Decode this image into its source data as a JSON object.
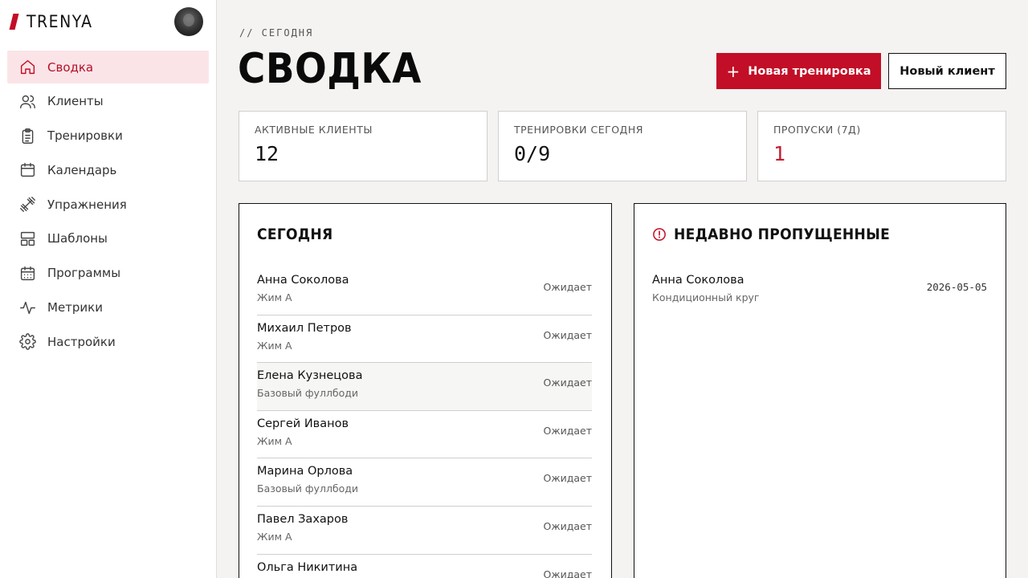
{
  "brand": {
    "name": "TRENYA"
  },
  "nav": [
    {
      "label": "Сводка",
      "icon": "home-icon",
      "active": true
    },
    {
      "label": "Клиенты",
      "icon": "users-icon"
    },
    {
      "label": "Тренировки",
      "icon": "clipboard-icon"
    },
    {
      "label": "Календарь",
      "icon": "calendar-icon"
    },
    {
      "label": "Упражнения",
      "icon": "dumbbell-icon"
    },
    {
      "label": "Шаблоны",
      "icon": "layout-icon"
    },
    {
      "label": "Программы",
      "icon": "calendar-grid-icon"
    },
    {
      "label": "Метрики",
      "icon": "activity-icon"
    },
    {
      "label": "Настройки",
      "icon": "gear-icon"
    }
  ],
  "header": {
    "eyebrow": "// СЕГОДНЯ",
    "title": "СВОДКА",
    "primary_button": "Новая тренировка",
    "secondary_button": "Новый клиент"
  },
  "stats": [
    {
      "label": "АКТИВНЫЕ КЛИЕНТЫ",
      "value": "12"
    },
    {
      "label": "ТРЕНИРОВКИ СЕГОДНЯ",
      "value": "0/9"
    },
    {
      "label": "ПРОПУСКИ (7Д)",
      "value": "1"
    }
  ],
  "today": {
    "title": "СЕГОДНЯ",
    "rows": [
      {
        "name": "Анна Соколова",
        "workout": "Жим А",
        "status": "Ожидает"
      },
      {
        "name": "Михаил Петров",
        "workout": "Жим А",
        "status": "Ожидает"
      },
      {
        "name": "Елена Кузнецова",
        "workout": "Базовый фуллбоди",
        "status": "Ожидает"
      },
      {
        "name": "Сергей Иванов",
        "workout": "Жим А",
        "status": "Ожидает"
      },
      {
        "name": "Марина Орлова",
        "workout": "Базовый фуллбоди",
        "status": "Ожидает"
      },
      {
        "name": "Павел Захаров",
        "workout": "Жим А",
        "status": "Ожидает"
      },
      {
        "name": "Ольга Никитина",
        "workout": "",
        "status": "Ожидает"
      }
    ]
  },
  "missed": {
    "title": "НЕДАВНО ПРОПУЩЕННЫЕ",
    "rows": [
      {
        "name": "Анна Соколова",
        "workout": "Кондиционный круг",
        "date": "2026-05-05"
      }
    ]
  },
  "colors": {
    "accent": "#c20e26",
    "active_bg": "#fbe4e7",
    "alert": "#c21f35"
  }
}
